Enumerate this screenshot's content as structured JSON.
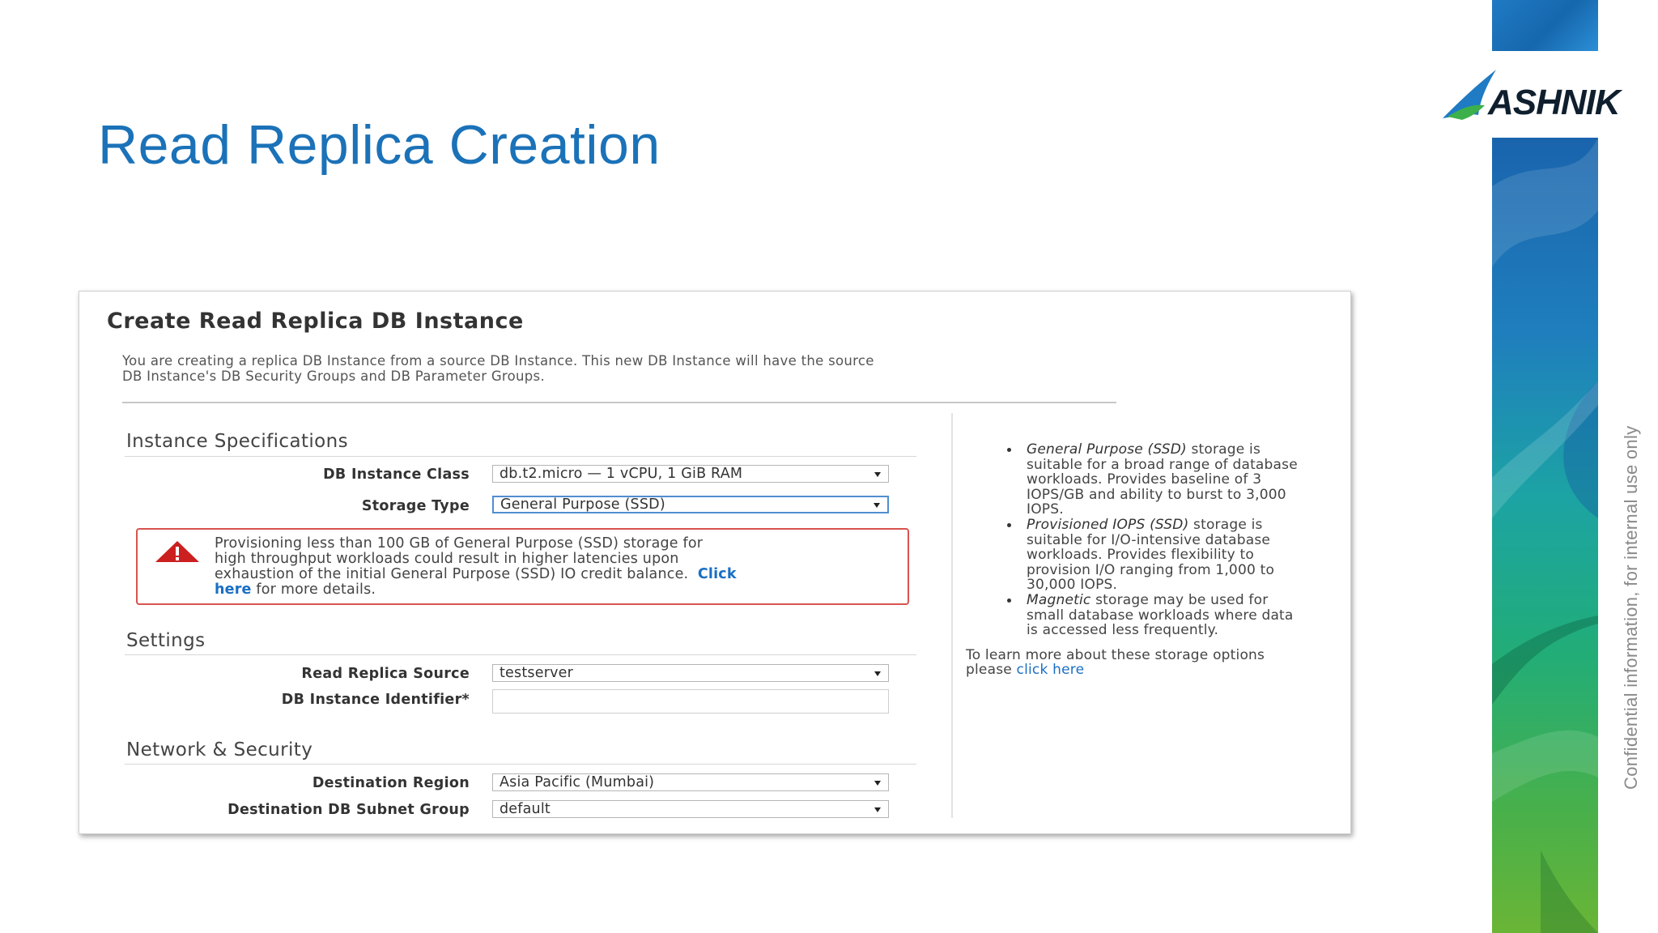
{
  "slide": {
    "title": "Read Replica Creation",
    "confidential": "Confidential information, for internal use only",
    "logo_text": "ASHNIK"
  },
  "colors": {
    "title_blue": "#1b72b8",
    "link_blue": "#1a6fc4",
    "alert_red": "#d9534f",
    "band_blue": "#1a64ad",
    "band_green": "#49b04a"
  },
  "panel": {
    "title": "Create Read Replica DB Instance",
    "description_line1": "You are creating a replica DB Instance from a source DB Instance. This new DB Instance will have the source",
    "description_line2": "DB Instance's DB Security Groups and DB Parameter Groups.",
    "sections": {
      "instance_specs": "Instance Specifications",
      "settings": "Settings",
      "network": "Network & Security"
    },
    "fields": {
      "db_instance_class": {
        "label": "DB Instance Class",
        "value": "db.t2.micro — 1 vCPU, 1 GiB RAM"
      },
      "storage_type": {
        "label": "Storage Type",
        "value": "General Purpose (SSD)"
      },
      "read_replica_source": {
        "label": "Read Replica Source",
        "value": "testserver"
      },
      "db_instance_identifier": {
        "label": "DB Instance Identifier*",
        "value": ""
      },
      "destination_region": {
        "label": "Destination Region",
        "value": "Asia Pacific (Mumbai)"
      },
      "destination_subnet_group": {
        "label": "Destination DB Subnet Group",
        "value": "default"
      }
    },
    "alert": {
      "icon": "warning-triangle-icon",
      "line1": "Provisioning less than 100 GB of General Purpose (SSD) storage for",
      "line2": "high throughput workloads could result in higher latencies upon",
      "line3": "exhaustion of the initial General Purpose (SSD) IO credit balance.",
      "link_part1": "Click",
      "link_part2": "here",
      "line4_tail": "for more details."
    },
    "help": {
      "item1_title": "General Purpose (SSD)",
      "item1_body": "storage is suitable for a broad range of database workloads. Provides baseline of 3 IOPS/GB and ability to burst to 3,000 IOPS.",
      "item2_title": "Provisioned IOPS (SSD)",
      "item2_body": "storage is suitable for I/O-intensive database workloads. Provides flexibility to provision I/O ranging from 1,000 to 30,000 IOPS.",
      "item3_title": "Magnetic",
      "item3_body": "storage may be used for small database workloads where data is accessed less frequently.",
      "footer_text": "To learn more about these storage options please",
      "footer_link_1": "click",
      "footer_link_2": "here"
    }
  }
}
